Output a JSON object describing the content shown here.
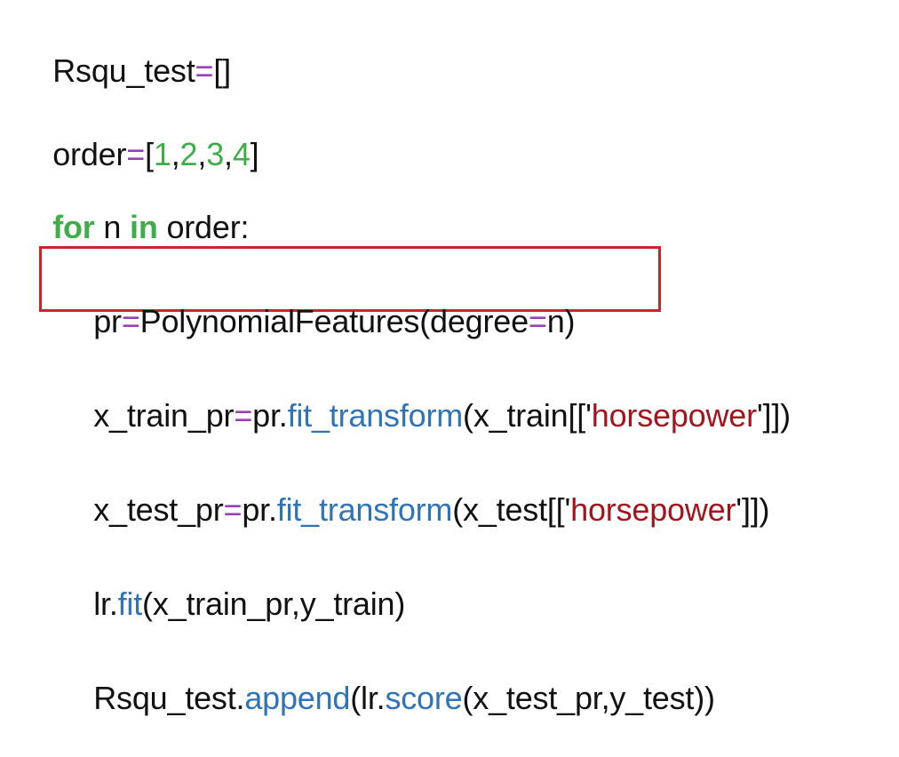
{
  "code_lines": [
    {
      "tokens": [
        {
          "text": "Rsqu_test",
          "kind": "plain"
        },
        {
          "text": "=",
          "kind": "op"
        },
        {
          "text": "[]",
          "kind": "plain"
        }
      ]
    },
    {
      "tokens": [
        {
          "text": "order",
          "kind": "plain"
        },
        {
          "text": "=",
          "kind": "op"
        },
        {
          "text": "[",
          "kind": "plain"
        },
        {
          "text": "1",
          "kind": "number"
        },
        {
          "text": ",",
          "kind": "plain"
        },
        {
          "text": "2",
          "kind": "number"
        },
        {
          "text": ",",
          "kind": "plain"
        },
        {
          "text": "3",
          "kind": "number"
        },
        {
          "text": ",",
          "kind": "plain"
        },
        {
          "text": "4",
          "kind": "number"
        },
        {
          "text": "]",
          "kind": "plain"
        }
      ]
    },
    {
      "tokens": [
        {
          "text": "for",
          "kind": "keyword"
        },
        {
          "text": " n ",
          "kind": "plain"
        },
        {
          "text": "in",
          "kind": "keyword"
        },
        {
          "text": " order:",
          "kind": "plain"
        }
      ]
    },
    {
      "highlighted": true,
      "tokens": [
        {
          "text": "pr",
          "kind": "plain"
        },
        {
          "text": "=",
          "kind": "op"
        },
        {
          "text": "PolynomialFeatures(degree",
          "kind": "plain"
        },
        {
          "text": "=",
          "kind": "op"
        },
        {
          "text": "n)",
          "kind": "plain"
        }
      ]
    },
    {
      "tokens": [
        {
          "text": "x_train_pr",
          "kind": "plain"
        },
        {
          "text": "=",
          "kind": "op"
        },
        {
          "text": "pr.",
          "kind": "plain"
        },
        {
          "text": "fit_transform",
          "kind": "method"
        },
        {
          "text": "(x_train[['",
          "kind": "plain"
        },
        {
          "text": "horsepower",
          "kind": "string"
        },
        {
          "text": "']])",
          "kind": "plain"
        }
      ]
    },
    {
      "tokens": [
        {
          "text": "x_test_pr",
          "kind": "plain"
        },
        {
          "text": "=",
          "kind": "op"
        },
        {
          "text": "pr.",
          "kind": "plain"
        },
        {
          "text": "fit_transform",
          "kind": "method"
        },
        {
          "text": "(x_test[['",
          "kind": "plain"
        },
        {
          "text": "horsepower",
          "kind": "string"
        },
        {
          "text": "']])",
          "kind": "plain"
        }
      ]
    },
    {
      "tokens": [
        {
          "text": "lr.",
          "kind": "plain"
        },
        {
          "text": "fit",
          "kind": "method"
        },
        {
          "text": "(x_train_pr,y_train)",
          "kind": "plain"
        }
      ]
    },
    {
      "tokens": [
        {
          "text": "Rsqu_test.",
          "kind": "plain"
        },
        {
          "text": "append",
          "kind": "method"
        },
        {
          "text": "(lr.",
          "kind": "plain"
        },
        {
          "text": "score",
          "kind": "method"
        },
        {
          "text": "(x_test_pr,y_test))",
          "kind": "plain"
        }
      ]
    }
  ],
  "colors": {
    "plain": "#111111",
    "operator": "#9b3fb8",
    "number": "#3fae49",
    "keyword": "#3fae49",
    "method": "#2f73b8",
    "string": "#a3141d",
    "highlight_border": "#c8262d"
  }
}
